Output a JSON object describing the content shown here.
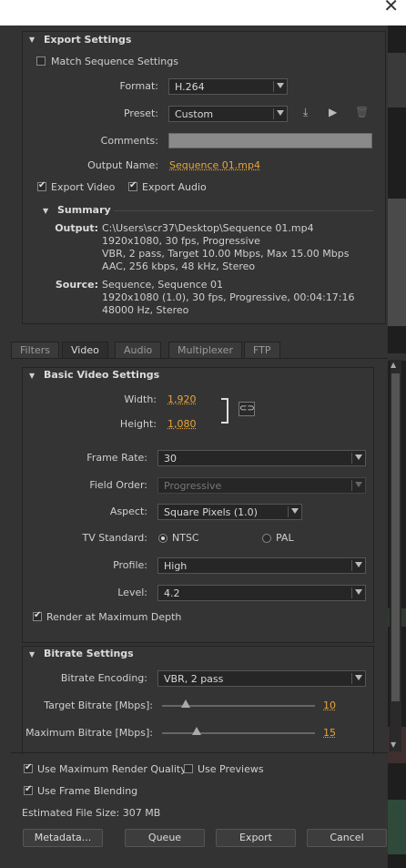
{
  "window": {
    "close_glyph": "✕"
  },
  "export_settings": {
    "title": "Export Settings",
    "match_sequence_label": "Match Sequence Settings",
    "format_label": "Format:",
    "format_value": "H.264",
    "preset_label": "Preset:",
    "preset_value": "Custom",
    "comments_label": "Comments:",
    "comments_value": "",
    "output_name_label": "Output Name:",
    "output_name_value": "Sequence 01.mp4",
    "export_video_label": "Export Video",
    "export_audio_label": "Export Audio"
  },
  "summary": {
    "title": "Summary",
    "output_label": "Output:",
    "output_lines": [
      "C:\\Users\\scr37\\Desktop\\Sequence 01.mp4",
      "1920x1080, 30 fps, Progressive",
      "VBR, 2 pass, Target 10.00 Mbps, Max 15.00 Mbps",
      "AAC, 256 kbps, 48 kHz, Stereo"
    ],
    "source_label": "Source:",
    "source_lines": [
      "Sequence, Sequence 01",
      "1920x1080 (1.0), 30 fps, Progressive, 00:04:17:16",
      "48000 Hz, Stereo"
    ]
  },
  "tabs": [
    "Filters",
    "Video",
    "Audio",
    "Multiplexer",
    "FTP"
  ],
  "basic_video": {
    "title": "Basic Video Settings",
    "width_label": "Width:",
    "width_value": "1,920",
    "height_label": "Height:",
    "height_value": "1,080",
    "frame_rate_label": "Frame Rate:",
    "frame_rate_value": "30",
    "field_order_label": "Field Order:",
    "field_order_value": "Progressive",
    "aspect_label": "Aspect:",
    "aspect_value": "Square Pixels (1.0)",
    "tv_standard_label": "TV Standard:",
    "ntsc_label": "NTSC",
    "pal_label": "PAL",
    "profile_label": "Profile:",
    "profile_value": "High",
    "level_label": "Level:",
    "level_value": "4.2",
    "render_max_depth_label": "Render at Maximum Depth"
  },
  "bitrate": {
    "title": "Bitrate Settings",
    "encoding_label": "Bitrate Encoding:",
    "encoding_value": "VBR, 2 pass",
    "target_label": "Target Bitrate [Mbps]:",
    "target_value": "10",
    "max_label": "Maximum Bitrate [Mbps]:",
    "max_value": "15"
  },
  "footer": {
    "use_max_render_label": "Use Maximum Render Quality",
    "use_previews_label": "Use Previews",
    "use_frame_blending_label": "Use Frame Blending",
    "file_size_text": "Estimated File Size:  307 MB",
    "metadata_button": "Metadata...",
    "queue_button": "Queue",
    "export_button": "Export",
    "cancel_button": "Cancel"
  }
}
